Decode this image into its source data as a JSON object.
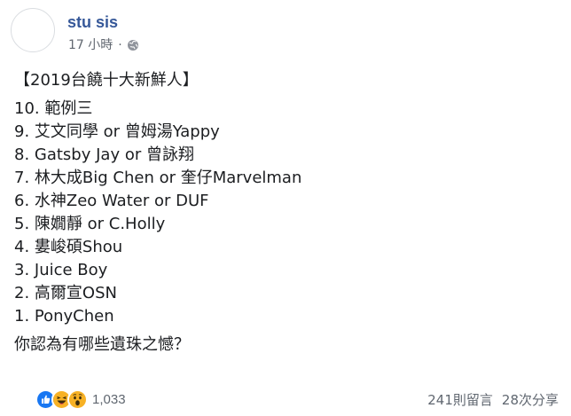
{
  "post": {
    "author": "stu sis",
    "time": "17 小時",
    "separator": "·",
    "privacy_icon": "globe-icon",
    "lines": [
      "【2019台饒十大新鮮人】",
      "",
      "10. 範例三",
      "9. 艾文同學 or 曾姆湯Yappy",
      "8. Gatsby Jay or 曾詠翔",
      "7. 林大成Big Chen or 奎仔Marvelman",
      "6. 水神Zeo Water or DUF",
      "5. 陳嫺靜 or C.Holly",
      "4. 婁峻碩Shou",
      "3. Juice Boy",
      "2. 高爾宣OSN",
      "1. PonyChen",
      "",
      "你認為有哪些遺珠之憾？"
    ]
  },
  "footer": {
    "reactions": [
      "like-reaction-icon",
      "haha-reaction-icon",
      "wow-reaction-icon"
    ],
    "reaction_count": "1,033",
    "comments": "241則留言",
    "shares": "28次分享"
  },
  "colors": {
    "author": "#365899",
    "meta": "#616770",
    "like": "#1877f2",
    "emoji_yellow": "#f7b125"
  }
}
